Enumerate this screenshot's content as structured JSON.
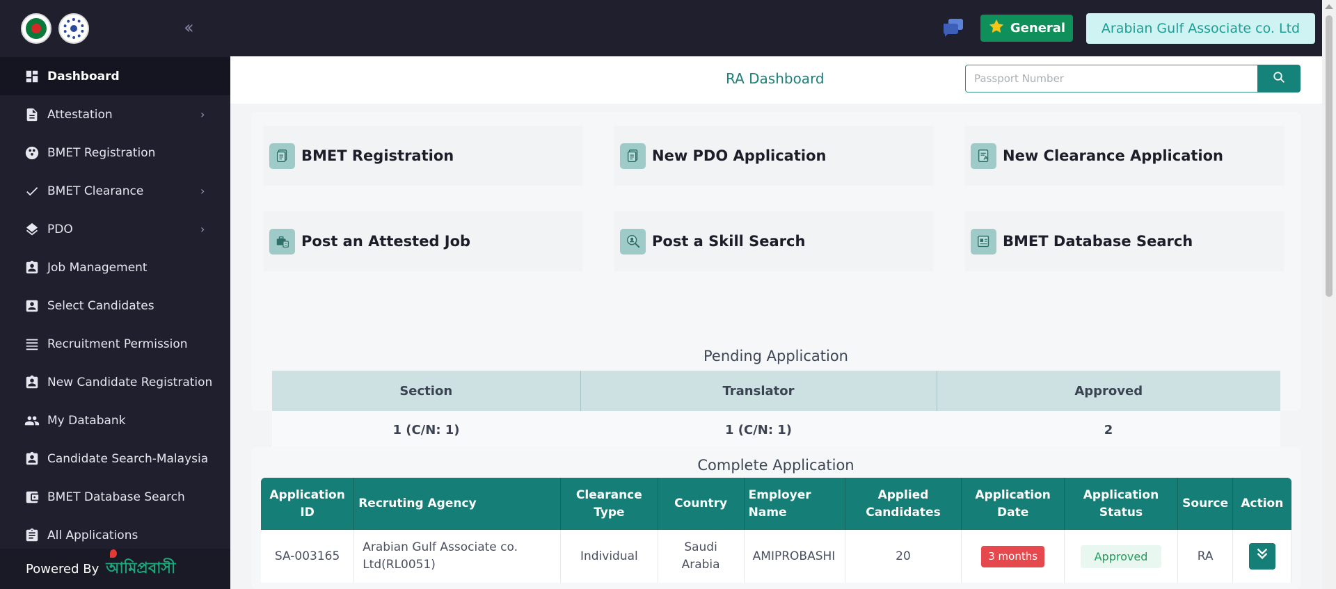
{
  "sidebar": {
    "items": [
      {
        "label": "Dashboard",
        "icon": "dashboard-icon",
        "has_submenu": false,
        "active": true
      },
      {
        "label": "Attestation",
        "icon": "document-icon",
        "has_submenu": true
      },
      {
        "label": "BMET Registration",
        "icon": "bowling-ball-icon",
        "has_submenu": false
      },
      {
        "label": "BMET Clearance",
        "icon": "checkmark-icon",
        "has_submenu": true
      },
      {
        "label": "PDO",
        "icon": "layers-icon",
        "has_submenu": true
      },
      {
        "label": "Job Management",
        "icon": "id-badge-icon",
        "has_submenu": false
      },
      {
        "label": "Select Candidates",
        "icon": "account-box-icon",
        "has_submenu": false
      },
      {
        "label": "Recruitment Permission",
        "icon": "list-lines-icon",
        "has_submenu": false
      },
      {
        "label": "New Candidate Registration",
        "icon": "id-badge-icon",
        "has_submenu": false
      },
      {
        "label": "My Databank",
        "icon": "people-icon",
        "has_submenu": false
      },
      {
        "label": "Candidate Search-Malaysia",
        "icon": "id-badge-icon",
        "has_submenu": false
      },
      {
        "label": "BMET Database Search",
        "icon": "wallet-icon",
        "has_submenu": false
      },
      {
        "label": "All Applications",
        "icon": "clipboard-icon",
        "has_submenu": false
      }
    ],
    "powered_by": "Powered By",
    "powered_logo_text": "আমিপ্রবাসী"
  },
  "topbar": {
    "category_badge": "General",
    "agency_name": "Arabian Gulf Associate co. Ltd"
  },
  "header": {
    "title": "RA Dashboard",
    "search_placeholder": "Passport Number"
  },
  "quick_actions": [
    {
      "label": "BMET Registration",
      "icon": "document-copy-icon"
    },
    {
      "label": "New PDO Application",
      "icon": "document-copy-icon"
    },
    {
      "label": "New Clearance Application",
      "icon": "document-signature-icon"
    },
    {
      "label": "Post an Attested Job",
      "icon": "briefcase-doc-icon"
    },
    {
      "label": "Post a Skill Search",
      "icon": "magnify-person-icon"
    },
    {
      "label": "BMET Database Search",
      "icon": "database-doc-icon"
    }
  ],
  "pending": {
    "title": "Pending Application",
    "columns": [
      "Section",
      "Translator",
      "Approved"
    ],
    "values": [
      "1 (C/N: 1)",
      "1 (C/N: 1)",
      "2"
    ]
  },
  "complete": {
    "title": "Complete Application",
    "columns": [
      "Application ID",
      "Recruting Agency",
      "Clearance Type",
      "Country",
      "Employer Name",
      "Applied Candidates",
      "Application Date",
      "Application Status",
      "Source",
      "Action"
    ],
    "rows": [
      {
        "id": "SA-003165",
        "agency": "Arabian Gulf Associate co. Ltd(RL0051)",
        "clearance_type": "Individual",
        "country": "Saudi Arabia",
        "employer": "AMIPROBASHI",
        "applied": "20",
        "date": "3 months",
        "status": "Approved",
        "source": "RA"
      }
    ]
  },
  "colors": {
    "sidebar_bg": "#1f1f2e",
    "accent_teal": "#147e77",
    "general_green": "#0f8f5a",
    "date_pill_red": "#e5484d"
  }
}
